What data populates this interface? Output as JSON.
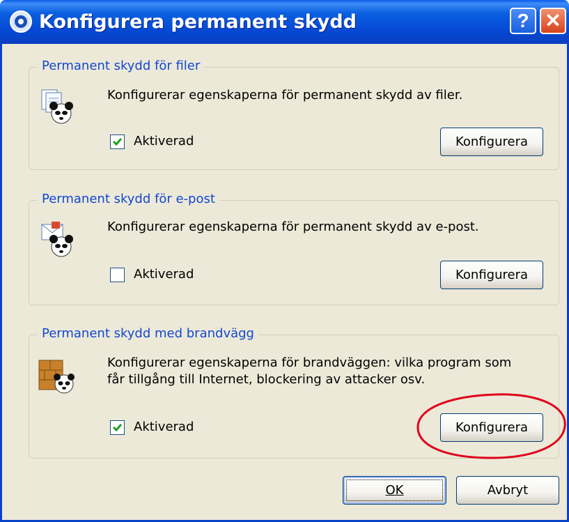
{
  "window": {
    "title": "Konfigurera permanent skydd",
    "help_label": "?",
    "close_label": "✕"
  },
  "groups": [
    {
      "legend": "Permanent skydd för filer",
      "description_lines": [
        "Konfigurerar egenskaperna för permanent skydd av filer."
      ],
      "checkbox_label": "Aktiverad",
      "checked": true,
      "button_label": "Konfigurera",
      "icon": "file-panda-icon"
    },
    {
      "legend": "Permanent skydd för e-post",
      "description_lines": [
        "Konfigurerar egenskaperna för permanent skydd av e-post."
      ],
      "checkbox_label": "Aktiverad",
      "checked": false,
      "button_label": "Konfigurera",
      "icon": "email-panda-icon"
    },
    {
      "legend": "Permanent skydd med brandvägg",
      "description_lines": [
        "Konfigurerar egenskaperna för brandväggen: vilka program som",
        "får tillgång till Internet, blockering av attacker osv."
      ],
      "checkbox_label": "Aktiverad",
      "checked": true,
      "button_label": "Konfigurera",
      "icon": "firewall-panda-icon"
    }
  ],
  "footer": {
    "ok_label": "OK",
    "cancel_label": "Avbryt"
  },
  "colors": {
    "titlebar": "#0548d4",
    "dialog_bg": "#ece9d8",
    "legend_text": "#1348d0",
    "annotation": "#e0001a",
    "checkmark": "#21a121"
  }
}
